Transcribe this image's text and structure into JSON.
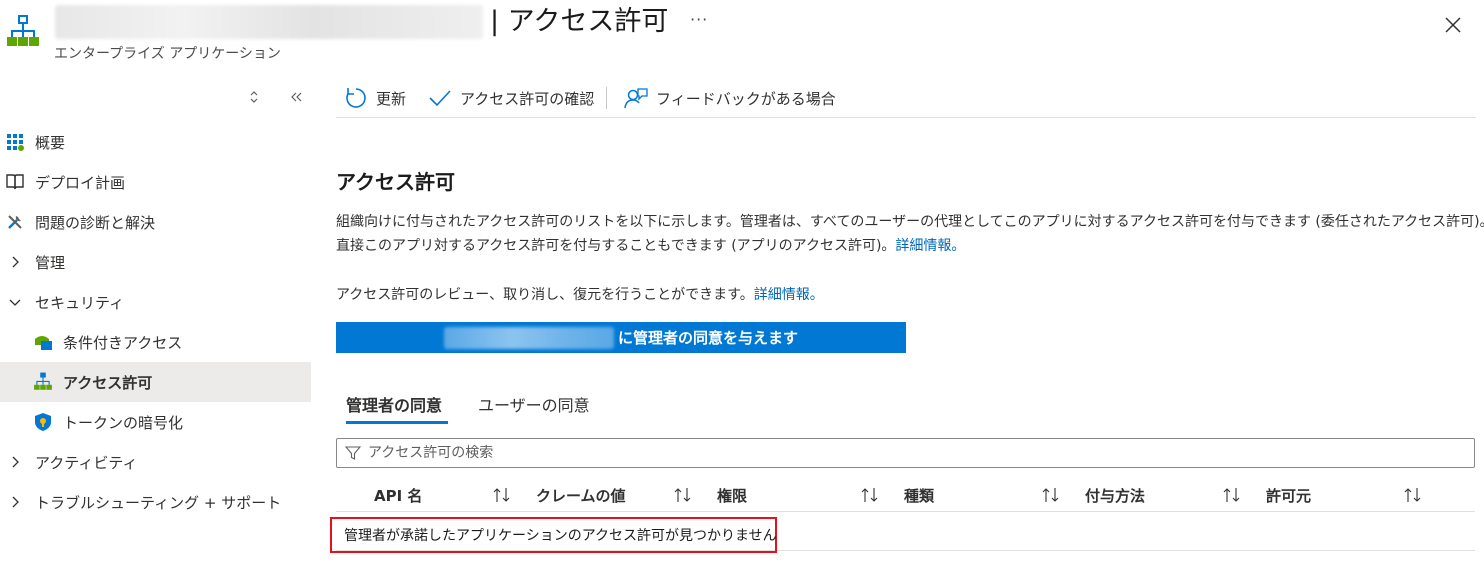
{
  "header": {
    "title": "| アクセス許可",
    "subtitle": "エンタープライズ アプリケーション",
    "more_label": "···"
  },
  "sidebar": {
    "items": [
      {
        "label": "概要"
      },
      {
        "label": "デプロイ計画"
      },
      {
        "label": "問題の診断と解決"
      },
      {
        "label": "管理"
      },
      {
        "label": "セキュリティ"
      },
      {
        "label": "条件付きアクセス"
      },
      {
        "label": "アクセス許可"
      },
      {
        "label": "トークンの暗号化"
      },
      {
        "label": "アクティビティ"
      },
      {
        "label": "トラブルシューティング + サポート"
      }
    ]
  },
  "toolbar": {
    "refresh_label": "更新",
    "review_label": "アクセス許可の確認",
    "feedback_label": "フィードバックがある場合"
  },
  "main": {
    "section_title": "アクセス許可",
    "desc_line1": "組織向けに付与されたアクセス許可のリストを以下に示します。管理者は、すべてのユーザーの代理としてこのアプリに対するアクセス許可を付与できます (委任されたアクセス許可)。",
    "desc_line2": "直接このアプリ対するアクセス許可を付与することもできます (アプリのアクセス許可)。",
    "learn_more": "詳細情報。",
    "desc_line3": "アクセス許可のレビュー、取り消し、復元を行うことができます。",
    "consent_button": "に管理者の同意を与えます"
  },
  "tabs": [
    {
      "label": "管理者の同意"
    },
    {
      "label": "ユーザーの同意"
    }
  ],
  "search": {
    "placeholder": "アクセス許可の検索"
  },
  "table": {
    "columns": [
      "API 名",
      "クレームの値",
      "権限",
      "種類",
      "付与方法",
      "許可元"
    ],
    "empty_message": "管理者が承諾したアプリケーションのアクセス許可が見つかりません"
  },
  "colors": {
    "accent": "#0078d4",
    "link": "#0067b8",
    "highlight_border": "#e8101c"
  }
}
